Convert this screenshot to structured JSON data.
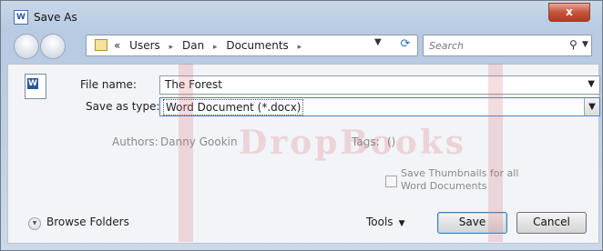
{
  "window": {
    "title": "Save As",
    "close_glyph": "x",
    "app_icon": "word-document-icon"
  },
  "nav": {
    "breadcrumb": [
      "«",
      "Users",
      "Dan",
      "Documents"
    ],
    "breadcrumb_separator": "▸",
    "search_placeholder": "Search"
  },
  "form": {
    "file_name_label": "File name:",
    "file_name_value": "The Forest",
    "save_as_type_label": "Save as type:",
    "save_as_type_value": "Word Document (*.docx)",
    "authors_label": "Authors:",
    "authors_value": "Danny Gookin",
    "tags_label": "Tags:",
    "tags_value": "()",
    "thumbnail_label": "Save Thumbnails for all Word Documents",
    "thumbnail_checked": false
  },
  "footer": {
    "browse_folders_label": "Browse Folders",
    "tools_label": "Tools",
    "save_label": "Save",
    "cancel_label": "Cancel"
  },
  "watermark": {
    "text": "DropBooks"
  },
  "colors": {
    "accent": "#3c7fb1",
    "close": "#c4553b",
    "frame": "#b8cbe2"
  }
}
